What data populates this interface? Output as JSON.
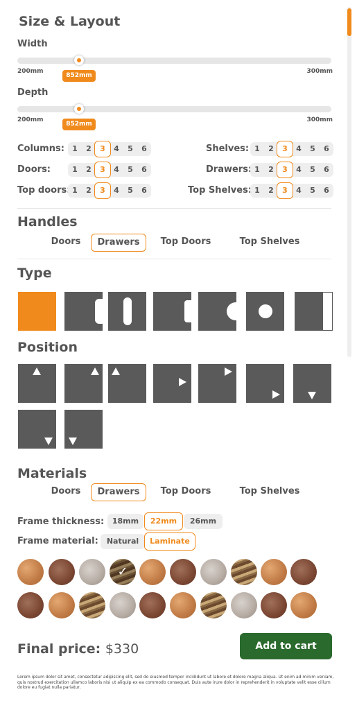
{
  "size_layout": {
    "title": "Size & Layout",
    "width": {
      "label": "Width",
      "min": "200mm",
      "max": "300mm",
      "value": "852mm",
      "position": 0.2
    },
    "depth": {
      "label": "Depth",
      "min": "200mm",
      "max": "300mm",
      "value": "852mm",
      "position": 0.2
    },
    "counters": {
      "options": [
        "1",
        "2",
        "3",
        "4",
        "5",
        "6"
      ],
      "columns": {
        "label": "Columns:",
        "selected": "3"
      },
      "doors": {
        "label": "Doors:",
        "selected": "3"
      },
      "top_doors": {
        "label": "Top doors:",
        "selected": "3"
      },
      "shelves": {
        "label": "Shelves:",
        "selected": "3"
      },
      "drawers": {
        "label": "Drawers:",
        "selected": "3"
      },
      "top_shelves": {
        "label": "Top Shelves:",
        "selected": "3"
      }
    }
  },
  "handles": {
    "title": "Handles",
    "tabs": [
      "Doors",
      "Drawers",
      "Top Doors",
      "Top Shelves"
    ],
    "selected_tab": "Drawers"
  },
  "type": {
    "title": "Type",
    "options": [
      "none-icon",
      "side-slots-icon",
      "vertical-slot-icon",
      "side-notches-icon",
      "half-circle-icon",
      "round-hole-icon",
      "edge-bar-icon"
    ],
    "selected": 0
  },
  "position": {
    "title": "Position",
    "options": [
      "top-center",
      "top-right",
      "top-left",
      "middle-right",
      "top-right-corner",
      "bottom-right",
      "bottom-center",
      "bottom-right-low",
      "bottom-left"
    ]
  },
  "materials": {
    "title": "Materials",
    "tabs": [
      "Doors",
      "Drawers",
      "Top Doors",
      "Top Shelves"
    ],
    "selected_tab": "Drawers",
    "frame_thickness": {
      "label": "Frame thickness:",
      "options": [
        "18mm",
        "22mm",
        "26mm"
      ],
      "selected": "22mm"
    },
    "frame_material": {
      "label": "Frame material:",
      "options": [
        "Natural",
        "Laminate"
      ],
      "selected": "Laminate"
    },
    "swatches_row1": [
      "oak",
      "walnut",
      "grey",
      "stripe",
      "oak",
      "walnut",
      "grey",
      "stripe",
      "oak",
      "walnut"
    ],
    "swatches_row2": [
      "walnut",
      "oak",
      "stripe",
      "grey",
      "walnut",
      "oak",
      "stripe",
      "grey",
      "walnut",
      "oak"
    ],
    "selected_swatch": 3
  },
  "footer": {
    "price_label": "Final price:",
    "price_value": "$330",
    "cart_label": "Add to cart",
    "disclaimer": "Lorem ipsum dolor sit amet, consectetur adipiscing elit, sed do eiusmod tempor incididunt ut labore et dolore magna aliqua. Ut enim ad minim veniam, quis nostrud exercitation ullamco laboris nisi ut aliquip ex ea commodo consequat. Duis aute irure dolor in reprehenderit in voluptate velit esse cillum dolore eu fugiat nulla pariatur."
  },
  "colors": {
    "accent": "#f08a1c",
    "tile": "#5a5a5a",
    "cart": "#2b6a2d"
  }
}
